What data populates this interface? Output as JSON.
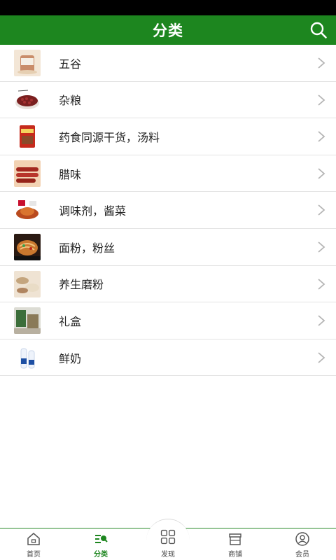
{
  "header": {
    "title": "分类"
  },
  "categories": [
    {
      "label": "五谷",
      "thumb": "grain-sack-image"
    },
    {
      "label": "杂粮",
      "thumb": "red-beans-image"
    },
    {
      "label": "药食同源干货，汤料",
      "thumb": "dried-goods-package-image"
    },
    {
      "label": "腊味",
      "thumb": "cured-sausage-image"
    },
    {
      "label": "调味剂，酱菜",
      "thumb": "roast-duck-image"
    },
    {
      "label": "面粉，粉丝",
      "thumb": "noodles-dish-image"
    },
    {
      "label": "养生磨粉",
      "thumb": "powder-bowls-image"
    },
    {
      "label": "礼盒",
      "thumb": "gift-box-image"
    },
    {
      "label": "鲜奶",
      "thumb": "milk-bottles-image"
    }
  ],
  "tabbar": {
    "items": [
      {
        "label": "首页",
        "icon": "home-icon"
      },
      {
        "label": "分类",
        "icon": "category-icon",
        "active": true
      },
      {
        "label": "发现",
        "icon": "grid-icon"
      },
      {
        "label": "商铺",
        "icon": "store-icon"
      },
      {
        "label": "会员",
        "icon": "user-icon"
      }
    ]
  },
  "colors": {
    "brand": "#1d861f",
    "status_bar": "#000000"
  }
}
